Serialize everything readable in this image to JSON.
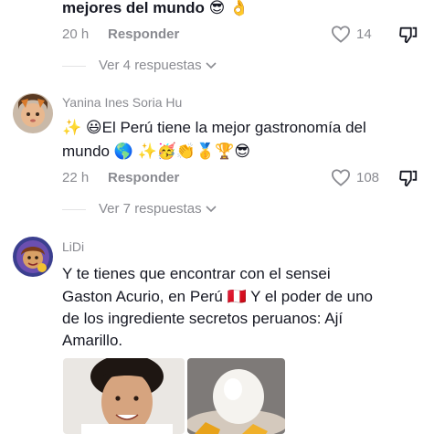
{
  "comment1": {
    "text_tail": "mejores del mundo 😎 👌",
    "time": "20 h",
    "reply_label": "Responder",
    "likes": "14",
    "view_replies": "Ver 4 respuestas"
  },
  "comment2": {
    "username": "Yanina Ines Soria Hu",
    "line1": "✨ 😃El Perú tiene la mejor gastronomía del",
    "line2": "mundo 🌎 ✨🥳👏🥇🏆😎",
    "time": "22 h",
    "reply_label": "Responder",
    "likes": "108",
    "view_replies": "Ver 7 respuestas"
  },
  "comment3": {
    "username": "LiDi",
    "line1": "Y te tienes que encontrar con el sensei",
    "line2": "Gaston Acurio, en Perú 🇵🇪 Y el poder de uno",
    "line3": "de los ingrediente secretos peruanos: Ají",
    "line4": "Amarillo."
  },
  "icons": {
    "heart": "heart-icon",
    "dislike": "dislike-icon",
    "chevron": "chevron-down-icon"
  }
}
